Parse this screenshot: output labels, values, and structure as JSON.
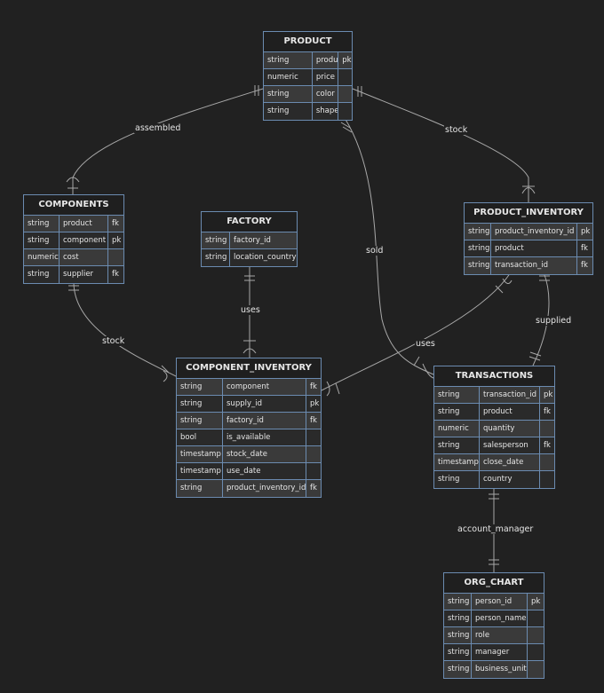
{
  "entities": {
    "product": {
      "title": "PRODUCT",
      "rows": [
        [
          "string",
          "product",
          "pk"
        ],
        [
          "numeric",
          "price",
          ""
        ],
        [
          "string",
          "color",
          ""
        ],
        [
          "string",
          "shape",
          ""
        ]
      ]
    },
    "components": {
      "title": "COMPONENTS",
      "rows": [
        [
          "string",
          "product",
          "fk"
        ],
        [
          "string",
          "component",
          "pk"
        ],
        [
          "numeric",
          "cost",
          ""
        ],
        [
          "string",
          "supplier",
          "fk"
        ]
      ]
    },
    "factory": {
      "title": "FACTORY",
      "rows": [
        [
          "string",
          "factory_id"
        ],
        [
          "string",
          "location_country"
        ]
      ]
    },
    "product_inventory": {
      "title": "PRODUCT_INVENTORY",
      "rows": [
        [
          "string",
          "product_inventory_id",
          "pk"
        ],
        [
          "string",
          "product",
          "fk"
        ],
        [
          "string",
          "transaction_id",
          "fk"
        ]
      ]
    },
    "component_inventory": {
      "title": "COMPONENT_INVENTORY",
      "rows": [
        [
          "string",
          "component",
          "fk"
        ],
        [
          "string",
          "supply_id",
          "pk"
        ],
        [
          "string",
          "factory_id",
          "fk"
        ],
        [
          "bool",
          "is_available",
          ""
        ],
        [
          "timestamp",
          "stock_date",
          ""
        ],
        [
          "timestamp",
          "use_date",
          ""
        ],
        [
          "string",
          "product_inventory_id",
          "fk"
        ]
      ]
    },
    "transactions": {
      "title": "TRANSACTIONS",
      "rows": [
        [
          "string",
          "transaction_id",
          "pk"
        ],
        [
          "string",
          "product",
          "fk"
        ],
        [
          "numeric",
          "quantity",
          ""
        ],
        [
          "string",
          "salesperson",
          "fk"
        ],
        [
          "timestamp",
          "close_date",
          ""
        ],
        [
          "string",
          "country",
          ""
        ]
      ]
    },
    "org_chart": {
      "title": "ORG_CHART",
      "rows": [
        [
          "string",
          "person_id",
          "pk"
        ],
        [
          "string",
          "person_name",
          ""
        ],
        [
          "string",
          "role",
          ""
        ],
        [
          "string",
          "manager",
          ""
        ],
        [
          "string",
          "business_unit",
          ""
        ]
      ]
    }
  },
  "relationships": {
    "assembled": "assembled",
    "stock_product": "stock",
    "sold": "sold",
    "uses_factory": "uses",
    "stock_components": "stock",
    "uses_inventory": "uses",
    "supplied": "supplied",
    "account_manager": "account_manager"
  },
  "colors": {
    "background": "#212121",
    "line": "#a8a8a8",
    "border": "#6b8bb0",
    "text": "#e6e6e6"
  }
}
